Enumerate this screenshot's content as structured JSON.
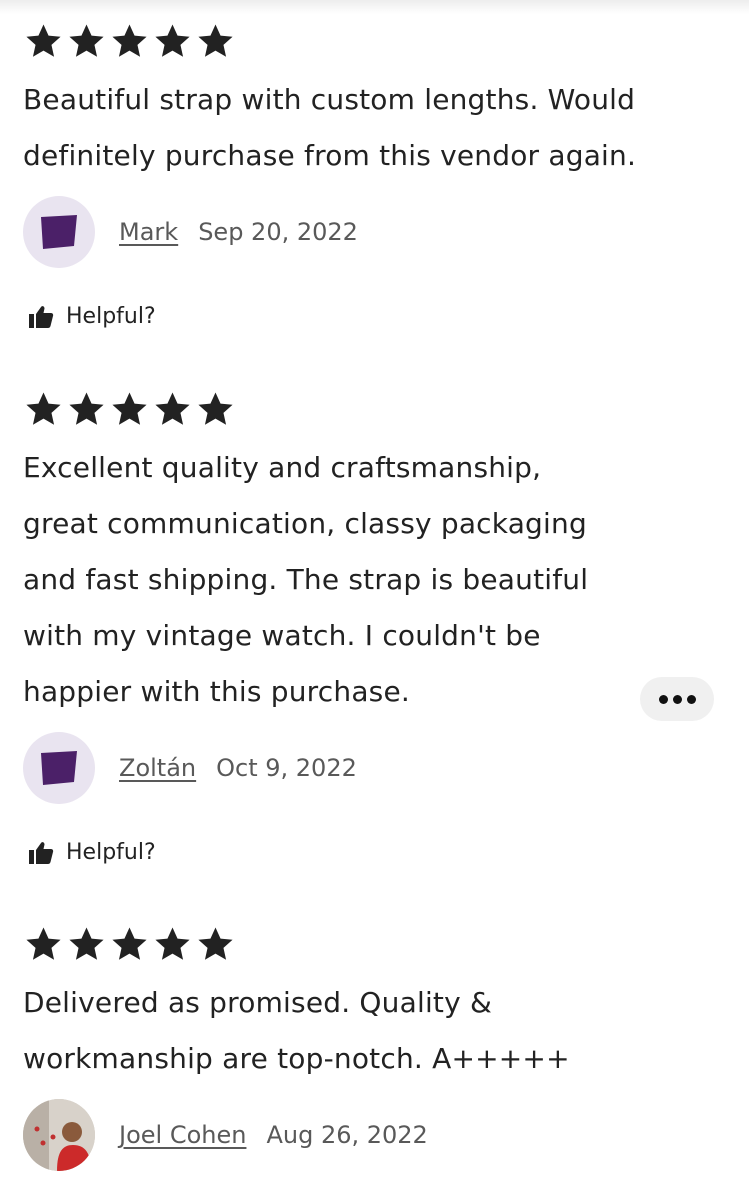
{
  "reviews": [
    {
      "rating": 5,
      "text": "Beautiful strap with custom lengths. Would\ndefinitely purchase from this vendor again.",
      "reviewer": "Mark",
      "date": "Sep 20, 2022",
      "avatar": "default-purple-avatar",
      "helpful_label": "Helpful?"
    },
    {
      "rating": 5,
      "text": "Excellent quality and craftsmanship,\ngreat communication, classy packaging\nand fast shipping. The strap is beautiful\nwith my vintage watch. I couldn't be\nhappier with this purchase.",
      "reviewer": "Zoltán",
      "date": "Oct 9, 2022",
      "avatar": "default-purple-avatar",
      "helpful_label": "Helpful?"
    },
    {
      "rating": 5,
      "text": "Delivered as promised. Quality &\nworkmanship are top-notch. A+++++",
      "reviewer": "Joel Cohen",
      "date": "Aug 26, 2022",
      "avatar": "photo-avatar"
    }
  ],
  "colors": {
    "text": "#222222",
    "muted": "#595959",
    "avatar_bg": "#e9e4f0",
    "avatar_shape": "#4b2068",
    "more_button_bg": "#f0f0f0"
  },
  "icons": {
    "star": "star-icon",
    "helpful": "thumbs-up-icon",
    "more": "more-horizontal-icon"
  }
}
